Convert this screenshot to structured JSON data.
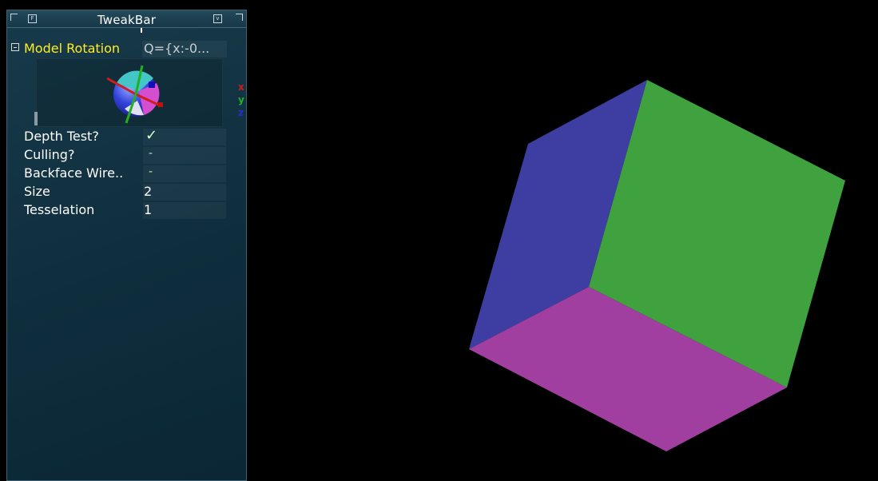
{
  "tweakbar": {
    "title": "TweakBar",
    "font_button": "F",
    "iconify_button": "v",
    "group_toggle": "−",
    "rotation": {
      "label": "Model Rotation",
      "value": "Q={x:-0...",
      "axis_legend": {
        "x": "x",
        "y": "y",
        "z": "z"
      },
      "axis_colors": {
        "x": "#d01c1c",
        "y": "#22b022",
        "z": "#2222cc"
      }
    },
    "rows": [
      {
        "label": "Depth Test?",
        "value": "✓",
        "kind": "bool",
        "checked": true
      },
      {
        "label": "Culling?",
        "value": "-",
        "kind": "bool",
        "checked": false
      },
      {
        "label": "Backface Wire..",
        "value": "-",
        "kind": "bool",
        "checked": false
      },
      {
        "label": "Size",
        "value": "2",
        "kind": "number"
      },
      {
        "label": "Tesselation",
        "value": "1",
        "kind": "number"
      }
    ]
  },
  "viewport": {
    "background": "#000000",
    "cube_face_colors": {
      "left": "#3e3ea2",
      "right": "#3fa23f",
      "bottom": "#a13fa1"
    }
  }
}
